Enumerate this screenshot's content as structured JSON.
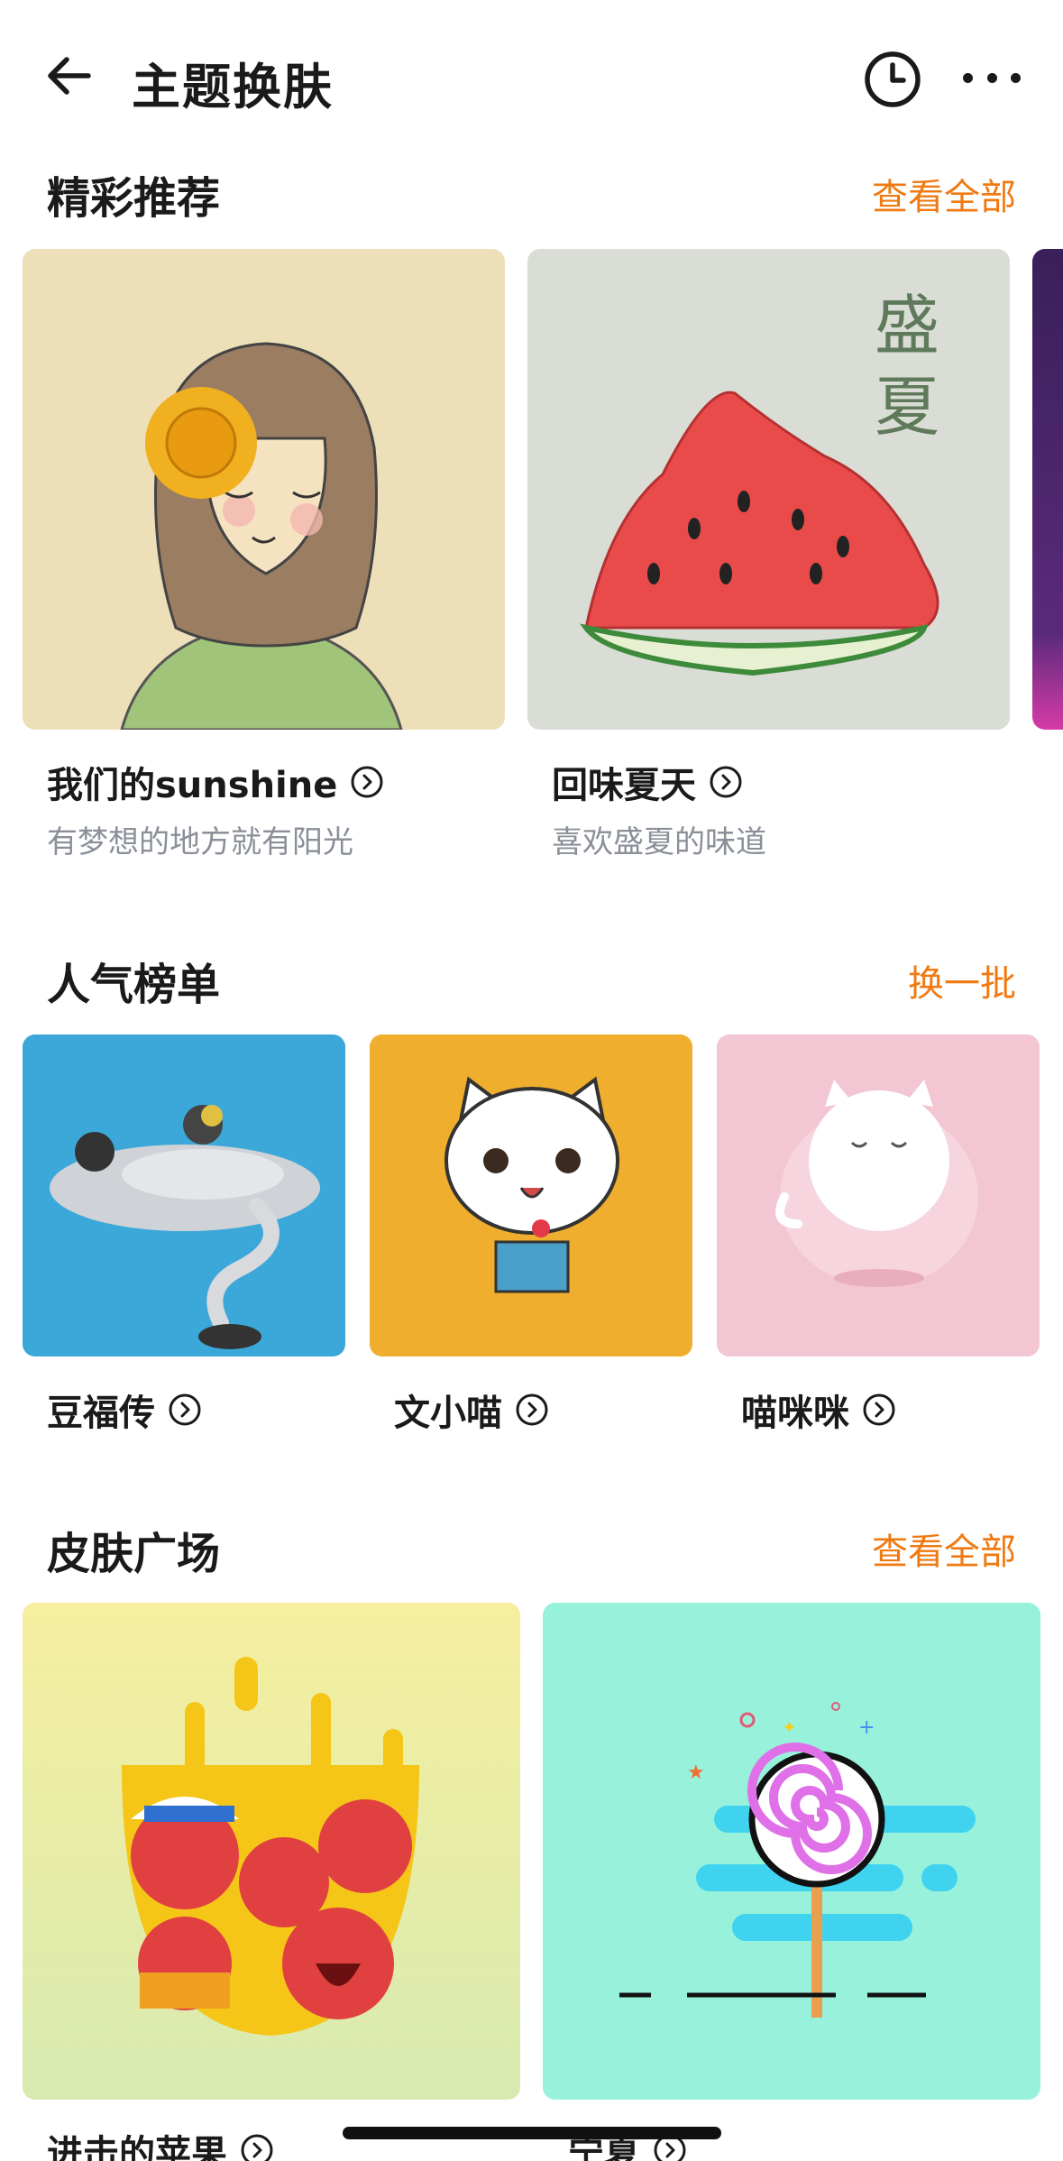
{
  "header": {
    "title": "主题换肤",
    "back_icon": "arrow-left-icon",
    "history_icon": "clock-icon",
    "more_icon": "more-dots-icon"
  },
  "featured": {
    "title": "精彩推荐",
    "action": "查看全部",
    "items": [
      {
        "name": "我们的sunshine",
        "desc": "有梦想的地方就有阳光"
      },
      {
        "name": "回味夏天",
        "desc": "喜欢盛夏的味道",
        "art_text": "盛夏"
      }
    ]
  },
  "ranking": {
    "title": "人气榜单",
    "action": "换一批",
    "items": [
      {
        "name": "豆福传"
      },
      {
        "name": "文小喵"
      },
      {
        "name": "喵咪咪"
      }
    ]
  },
  "square": {
    "title": "皮肤广场",
    "action": "查看全部",
    "items": [
      {
        "name": "进击的苹果"
      },
      {
        "name": "宁夏"
      }
    ]
  },
  "colors": {
    "accent": "#f07a12",
    "text": "#1a1a1a",
    "subtext": "#8a8f98"
  }
}
